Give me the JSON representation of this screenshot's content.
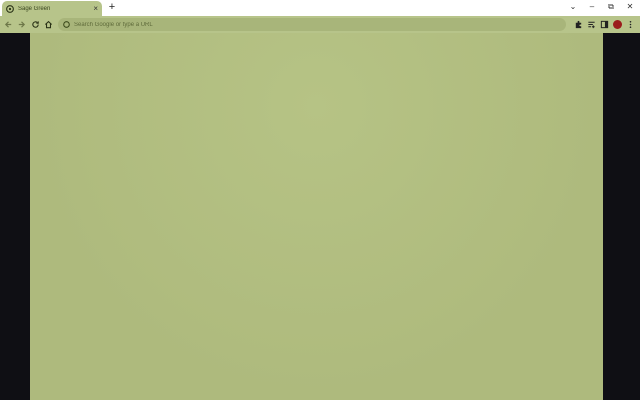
{
  "tab": {
    "title": "Sage Green",
    "favicon": "site-favicon-icon"
  },
  "window_controls": {
    "dropdown": "⌄",
    "minimize": "–",
    "restore": "⧉",
    "close": "✕"
  },
  "toolbar": {
    "omnibox_placeholder": "Search Google or type a URL"
  },
  "colors": {
    "theme_frame": "#b7c48a",
    "page_background": "#b0bd80",
    "side_background": "#0f0f14"
  }
}
